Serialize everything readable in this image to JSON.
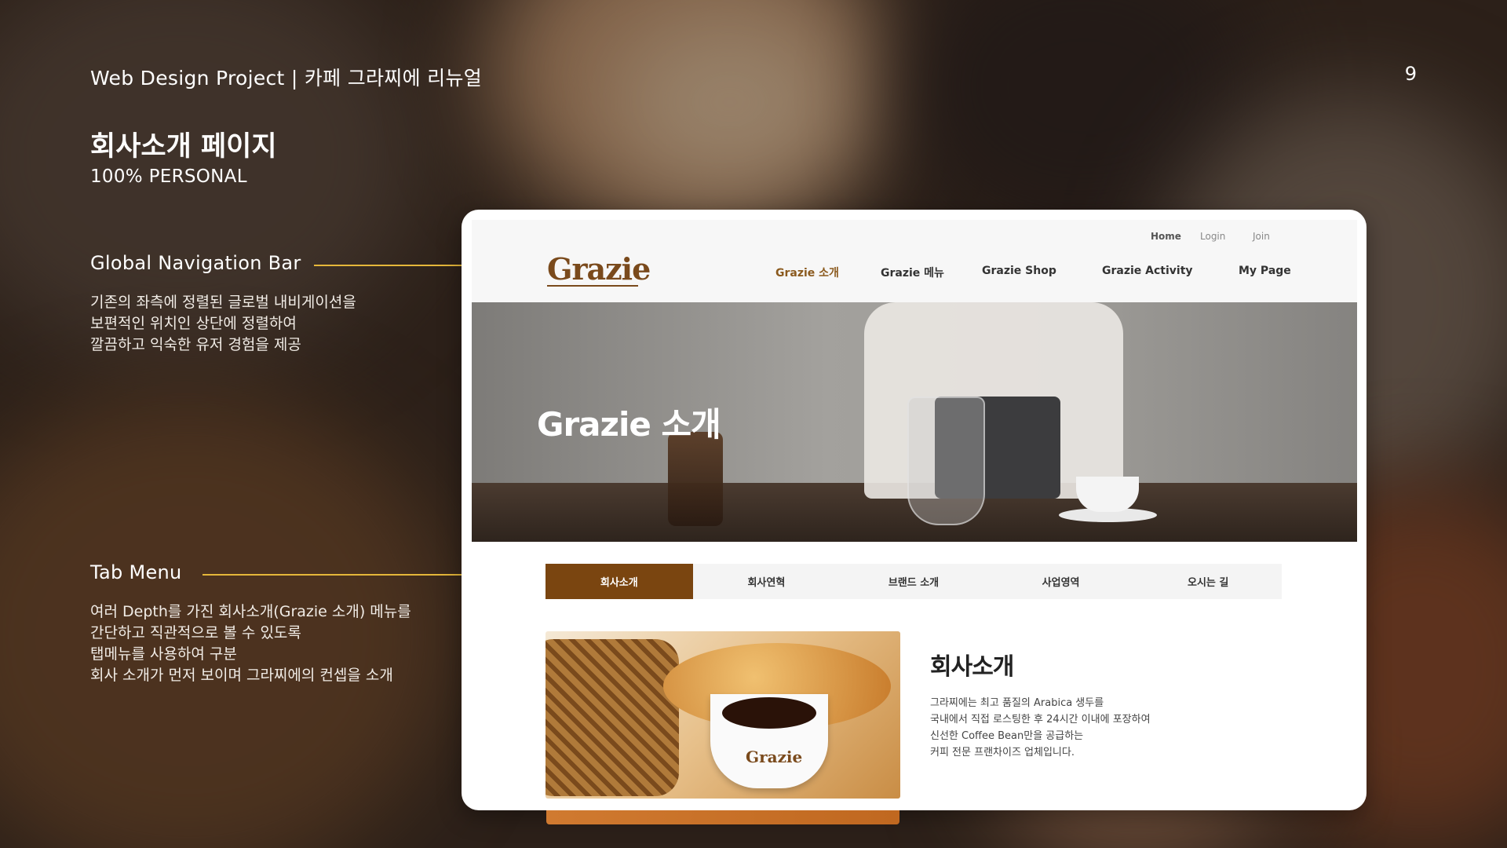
{
  "slide": {
    "title": "Web Design Project | 카페 그라찌에 리뉴얼",
    "page_number": "9",
    "section_title": "회사소개 페이지",
    "section_subtitle": "100% PERSONAL"
  },
  "annotations": [
    {
      "title": "Global Navigation Bar",
      "lines": [
        "기존의 좌측에 정렬된 글로벌 내비게이션을",
        "보편적인 위치인 상단에 정렬하여",
        "깔끔하고 익숙한 유저 경험을 제공"
      ]
    },
    {
      "title": "Tab Menu",
      "lines": [
        "여러 Depth를 가진 회사소개(Grazie 소개) 메뉴를",
        "간단하고 직관적으로 볼 수 있도록",
        "탭메뉴를 사용하여 구분",
        "회사 소개가 먼저 보이며 그라찌에의 컨셉을 소개"
      ]
    }
  ],
  "mockup": {
    "util_links": [
      "Home",
      "Login",
      "Join"
    ],
    "logo": "Grazie",
    "nav": [
      "Grazie 소개",
      "Grazie 메뉴",
      "Grazie Shop",
      "Grazie Activity",
      "My Page"
    ],
    "active_nav": "Grazie 소개",
    "hero_title": "Grazie 소개",
    "tabs": [
      "회사소개",
      "회사연혁",
      "브랜드 소개",
      "사업영역",
      "오시는 길"
    ],
    "active_tab": "회사소개",
    "cup_logo": "Grazie",
    "intro": {
      "title": "회사소개",
      "lines": [
        "그라찌에는 최고 품질의 Arabica 생두를",
        "국내에서 직접 로스팅한 후 24시간 이내에 포장하여",
        "신선한 Coffee Bean만을 공급하는",
        "커피 전문 프랜차이즈 업체입니다."
      ]
    }
  },
  "colors": {
    "accent_brown": "#7a4510",
    "annotation_line": "#e5b73a",
    "annotation_dot": "#f0c030"
  }
}
